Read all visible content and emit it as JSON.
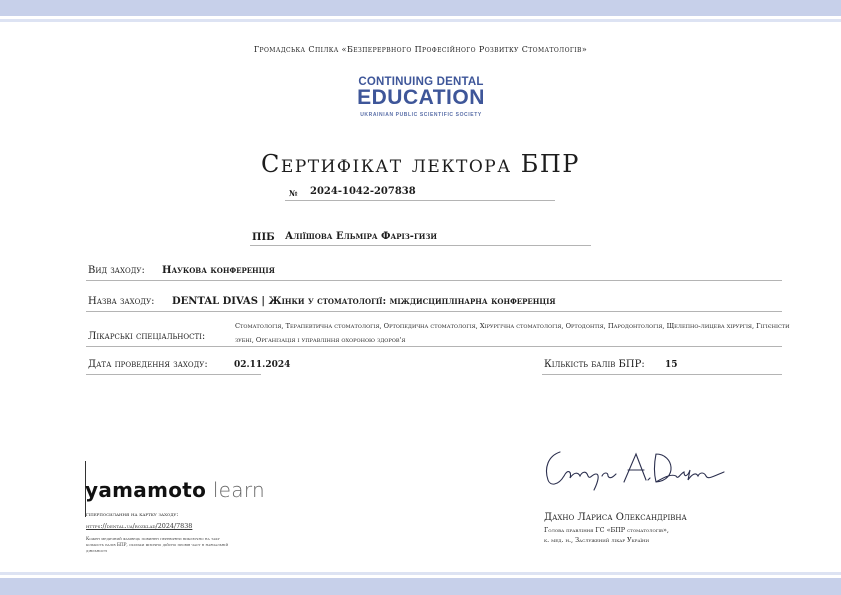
{
  "organization": "Громадська Спілка «Безперервного Професійного Розвитку Стоматологів»",
  "logo": {
    "line1": "CONTINUING DENTAL",
    "line2": "EDUCATION",
    "line3": "UKRAINIAN PUBLIC SCIENTIFIC SOCIETY"
  },
  "title": "Сертифікат лектора БПР",
  "certificate": {
    "number_label": "№",
    "number": "2024-1042-207838",
    "name_label": "ПІБ",
    "name": "Аліїшова Ельміра Фаріз-гизи"
  },
  "fields": {
    "event_type_label": "Вид заходу:",
    "event_type": "Наукова конференція",
    "event_name_label": "Назва заходу:",
    "event_name": "DENTAL DIVAS | Жінки у стоматології: міждисциплінарна конференція",
    "specialties_label": "Лікарські спеціальності:",
    "specialties": "Стоматологія, Терапевтична стоматологія, Ортопедична стоматологія, Хірургічна стоматологія, Ортодонтія, Пародонтологія, Щелепно-лицева хірургія, Гігієністи зубні, Організація і управління охороною здоров'я",
    "date_label": "Дата проведення заходу:",
    "date": "02.11.2024",
    "points_label": "Кількість балів БПР:",
    "points": "15"
  },
  "partner": {
    "brand_word1": "yamamoto",
    "brand_word2": "learn",
    "link_label": "гіперпосилання на картку заходу:",
    "link": "https://dental.ua/rozklad/2024/7838",
    "fine_print": "Кожен медичний фахівець повинен перевіряти виключно на таку кількість балів БПР, скільки фізично дійсно провів часу в навчальній діяльності"
  },
  "signer": {
    "signature_text": "Larysa A. Dakhno",
    "name": "Дахно Лариса Олександрівна",
    "role": "Голова правління ГС «БПР стоматологів»,",
    "degree": "к. мед. н., Заслужений лікар України"
  },
  "colors": {
    "band": "#c7d0ea",
    "logo_blue": "#3e5699",
    "signature_ink": "#2b2f4e"
  }
}
